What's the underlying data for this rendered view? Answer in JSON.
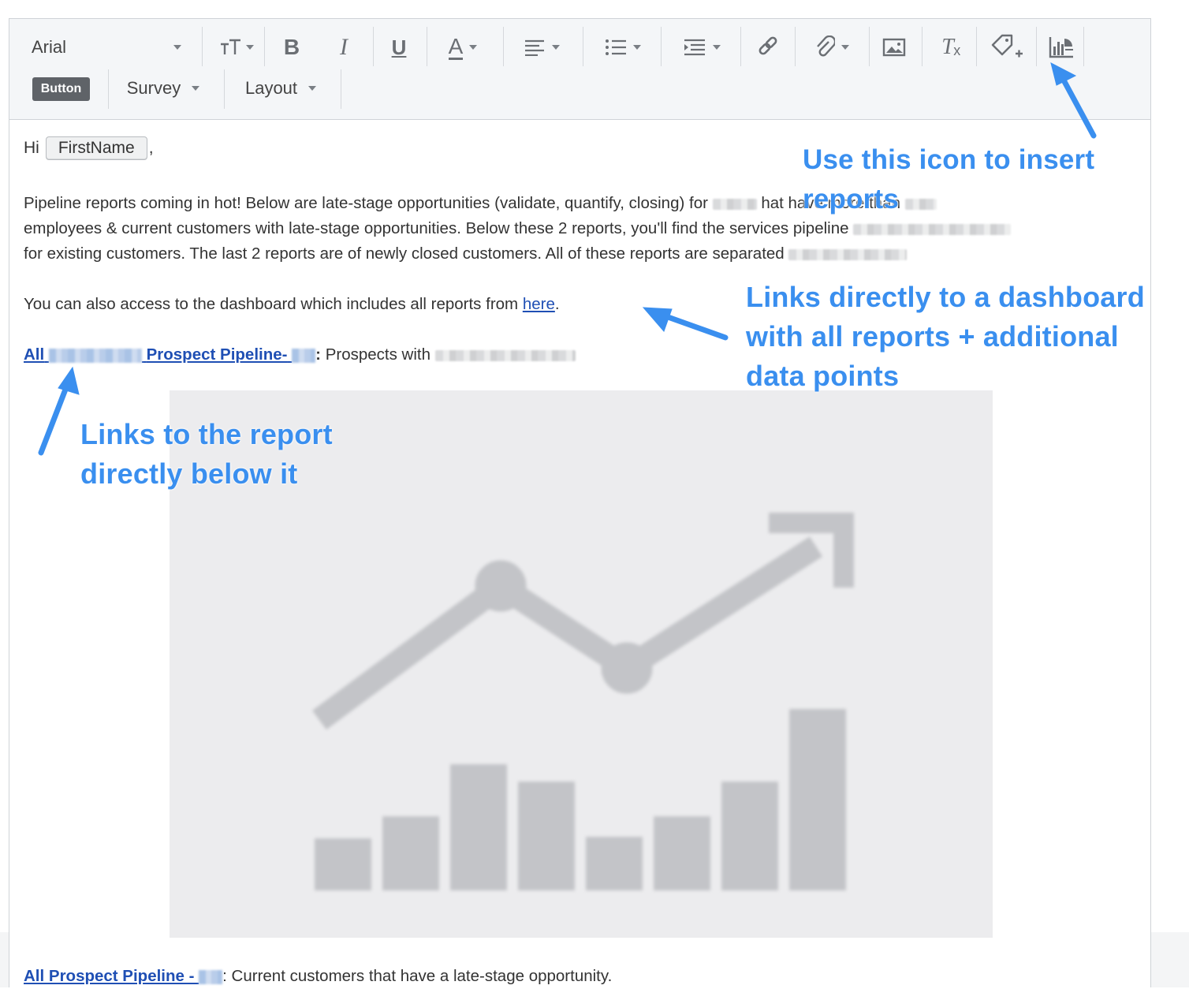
{
  "toolbar": {
    "font_family": "Arial",
    "button_chip_label": "Button",
    "survey_label": "Survey",
    "layout_label": "Layout",
    "bold_glyph": "B",
    "italic_glyph": "I",
    "underline_glyph": "U",
    "font_color_glyph": "A",
    "clear_format_glyph": "T"
  },
  "email": {
    "greeting_prefix": "Hi",
    "merge_tag": "FirstName",
    "greeting_suffix": ",",
    "para1_a": "Pipeline reports coming in hot! Below are late-stage opportunities (validate, quantify, closing) for",
    "para1_b": "hat have more than",
    "para1_c": "employees & current customers with late-stage opportunities. Below these 2 reports, you'll find the services pipeline",
    "para1_d": "for existing customers. The last 2 reports are of newly closed customers. All of these reports are separated",
    "para2_text": "You can also access to the dashboard which includes all reports from",
    "para2_link": "here",
    "para2_end": ".",
    "report1_link_a": "All",
    "report1_link_b": "Prospect Pipeline-",
    "report1_colon": ":",
    "report1_desc": "Prospects with",
    "report2_link": "All Prospect Pipeline - ",
    "report2_desc": ": Current customers that have a late-stage opportunity."
  },
  "annotations": {
    "insert_reports": "Use this icon to insert reports",
    "dashboard_link": "Links directly to a dashboard with all reports + additional data points",
    "report_link": "Links to the report directly below it"
  },
  "colors": {
    "annotation_blue": "#3a8fef",
    "link_blue": "#1f4fb4",
    "toolbar_bg": "#f4f6f8"
  }
}
